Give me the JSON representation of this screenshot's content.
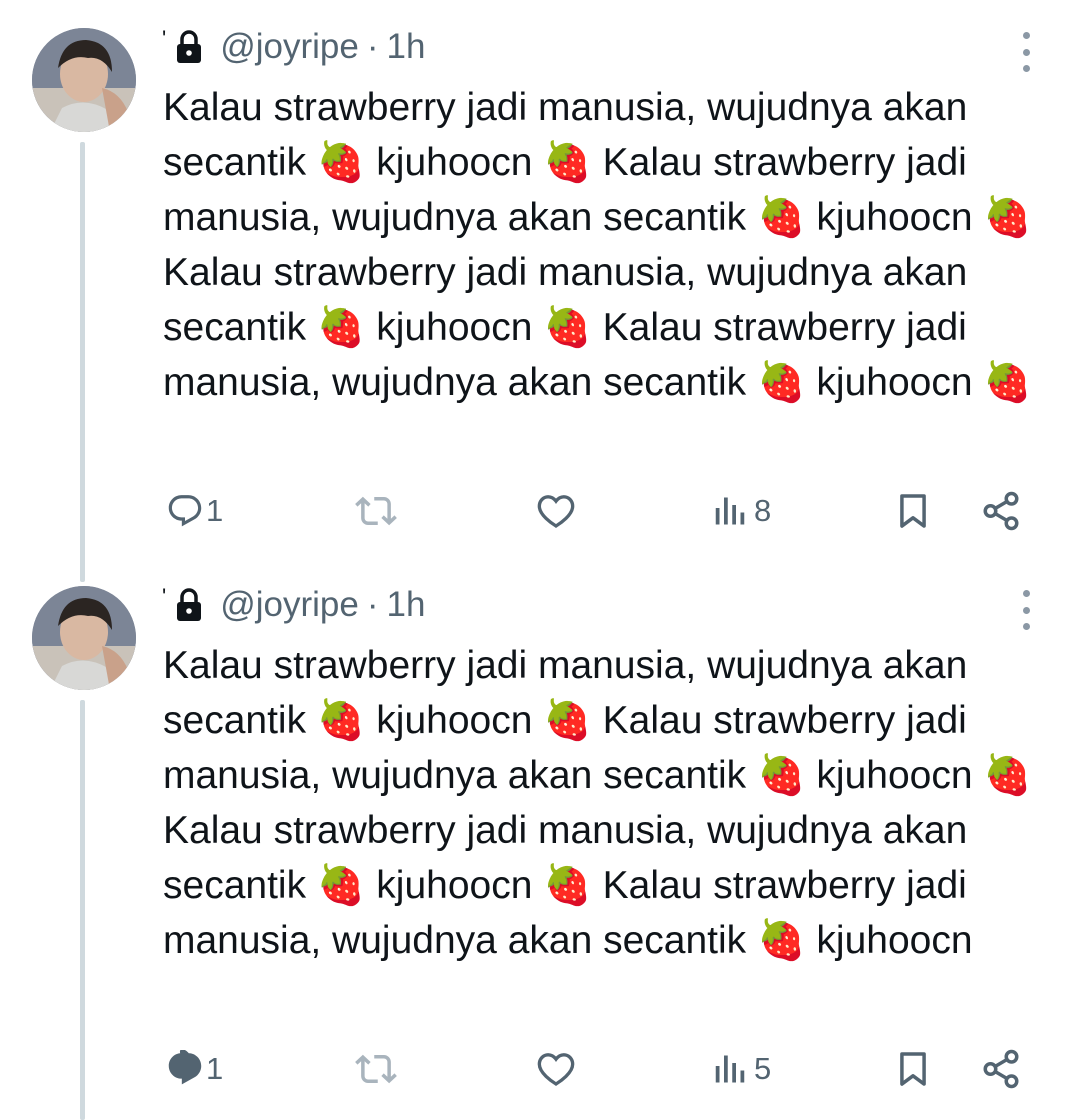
{
  "tweets": [
    {
      "handle": "@joyripe",
      "separator": "·",
      "time": "1h",
      "text": "Kalau strawberry jadi manusia, wujudnya akan secantik 🍓 kjuhoocn 🍓 Kalau strawberry jadi manusia, wujudnya akan secantik 🍓 kjuhoocn 🍓 Kalau strawberry jadi manusia, wujudnya akan secantik 🍓 kjuhoocn 🍓 Kalau strawberry jadi manusia, wujudnya akan secantik 🍓 kjuhoocn 🍓",
      "reply_count": "1",
      "repost_count": "",
      "like_count": "",
      "view_count": "8"
    },
    {
      "handle": "@joyripe",
      "separator": "·",
      "time": "1h",
      "text": "Kalau strawberry jadi manusia, wujudnya akan secantik 🍓 kjuhoocn 🍓 Kalau strawberry jadi manusia, wujudnya akan secantik 🍓 kjuhoocn 🍓 Kalau strawberry jadi manusia, wujudnya akan secantik 🍓 kjuhoocn 🍓 Kalau strawberry jadi manusia, wujudnya akan secantik 🍓 kjuhoocn",
      "reply_count": "1",
      "repost_count": "",
      "like_count": "",
      "view_count": "5"
    }
  ],
  "icons": {
    "lock": "lock-icon",
    "more": "more-options-icon",
    "reply": "reply-icon",
    "repost": "repost-icon",
    "like": "like-icon",
    "views": "views-icon",
    "bookmark": "bookmark-icon",
    "share": "share-icon"
  },
  "colors": {
    "text": "#0f1419",
    "secondary": "#536471",
    "thread_line": "#cfd9de",
    "repost_icon": "#a9b4bd"
  }
}
